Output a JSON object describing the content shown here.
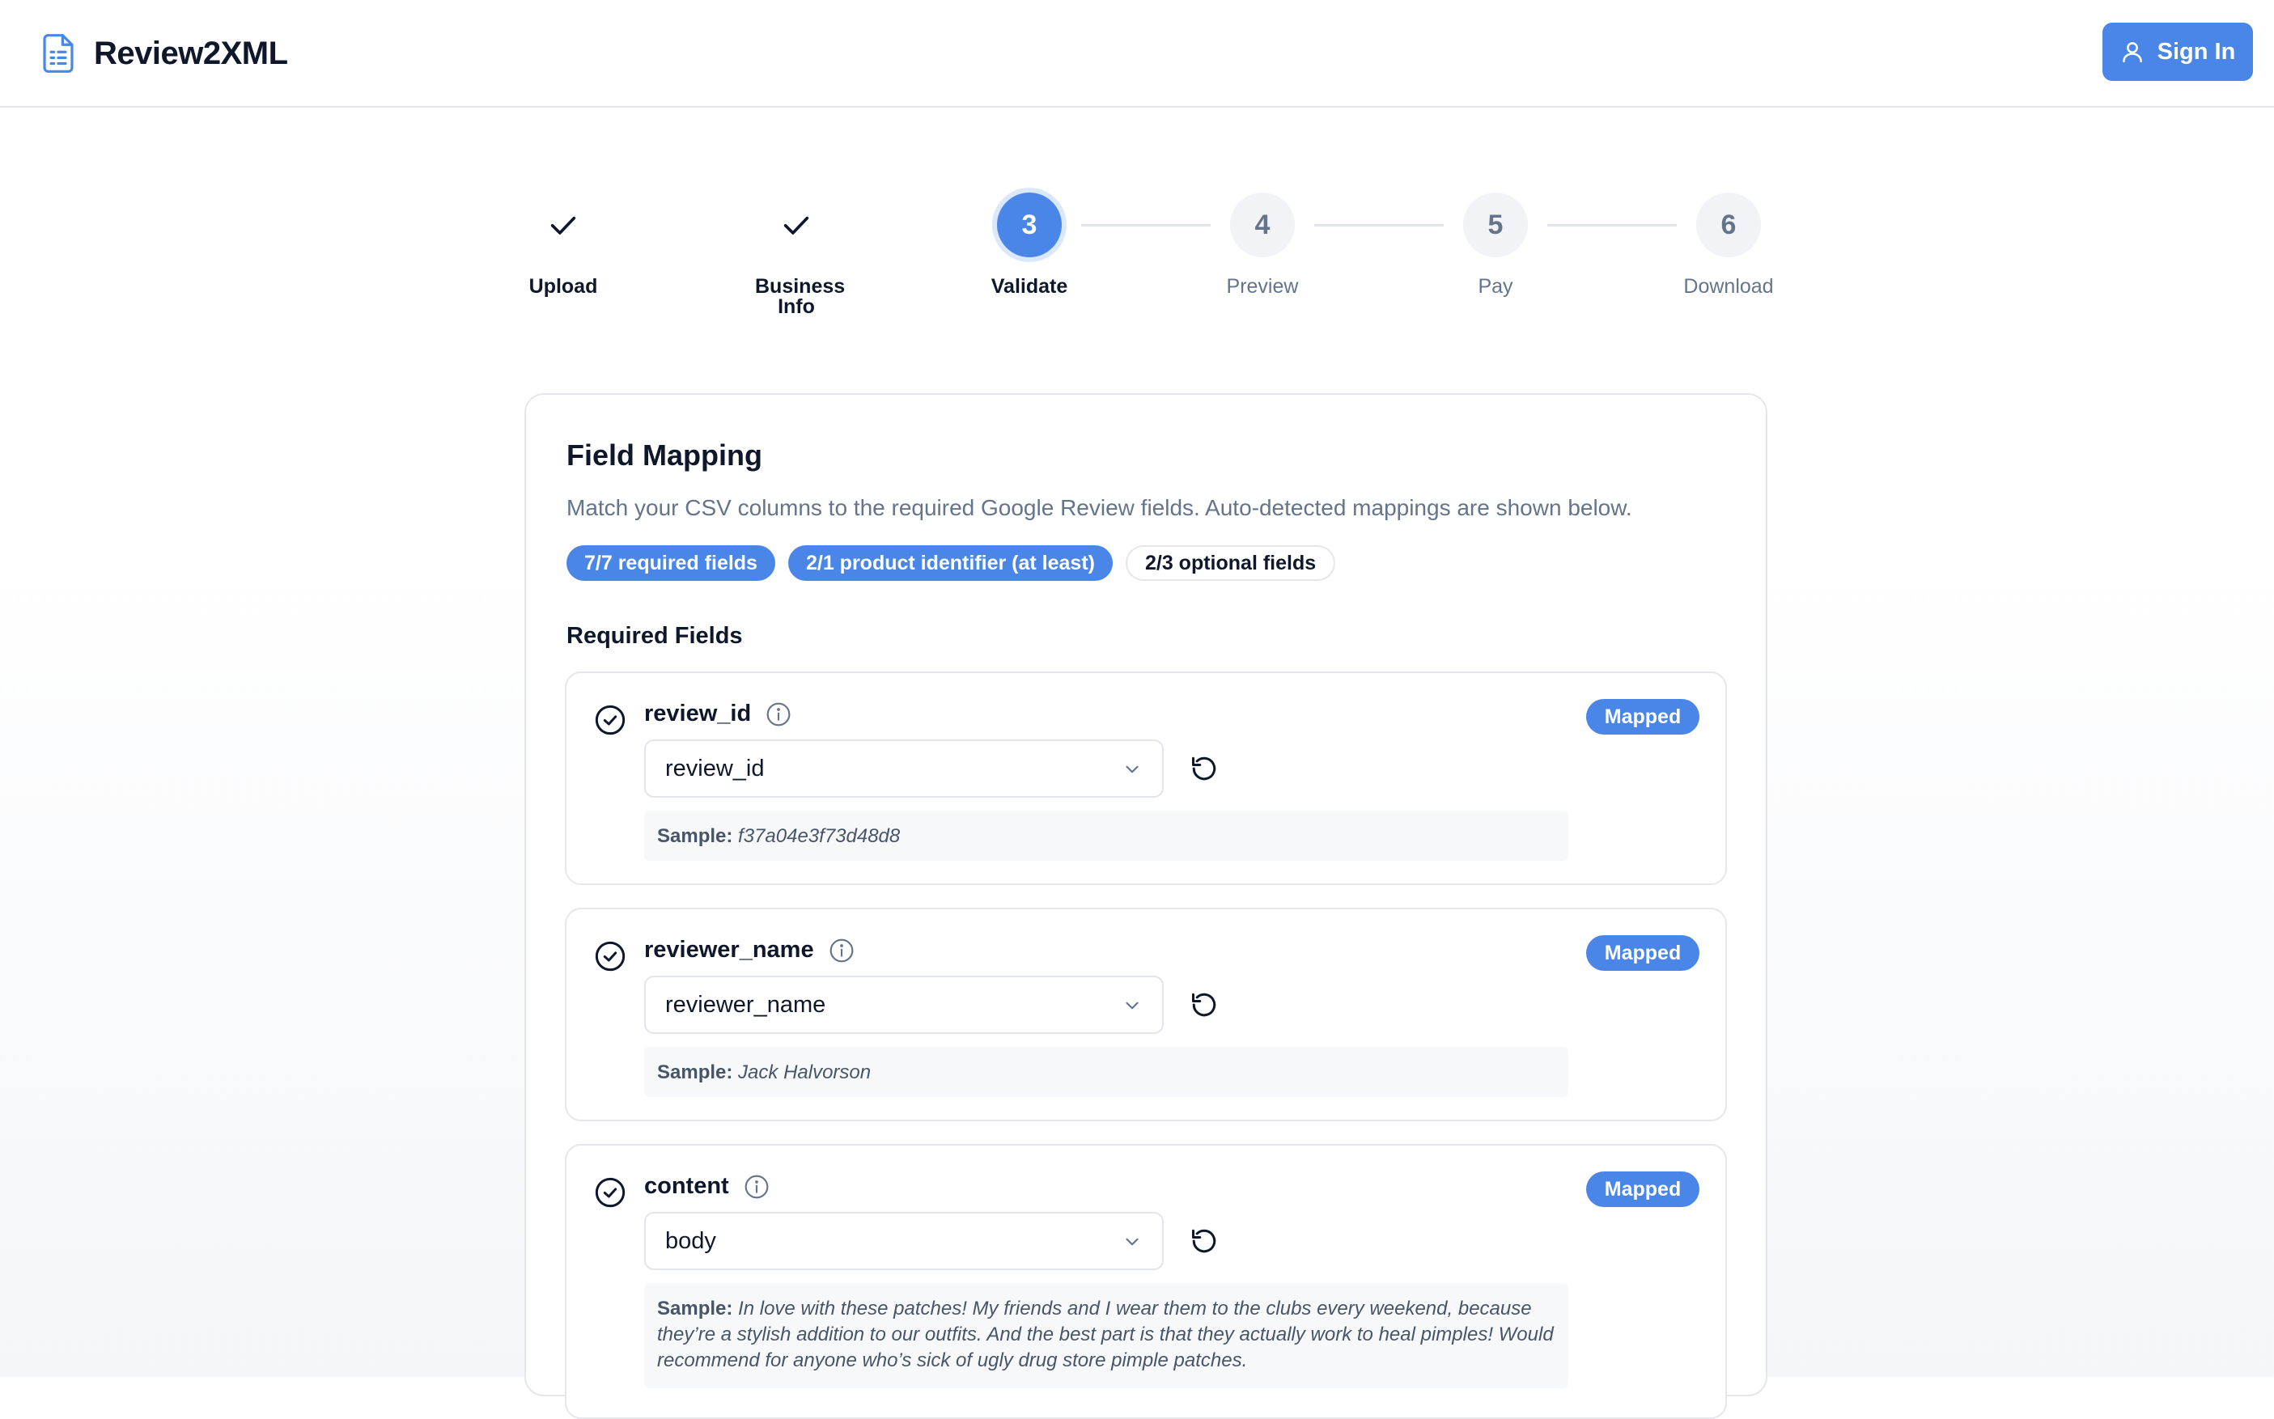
{
  "app": {
    "name": "Review2XML"
  },
  "header": {
    "signin_label": "Sign In"
  },
  "steps": [
    {
      "label": "Upload",
      "state": "done"
    },
    {
      "label": "Business Info",
      "state": "done"
    },
    {
      "label": "Validate",
      "number": "3",
      "state": "active"
    },
    {
      "label": "Preview",
      "number": "4",
      "state": "todo"
    },
    {
      "label": "Pay",
      "number": "5",
      "state": "todo"
    },
    {
      "label": "Download",
      "number": "6",
      "state": "todo"
    }
  ],
  "card": {
    "title": "Field Mapping",
    "description": "Match your CSV columns to the required Google Review fields. Auto-detected mappings are shown below.",
    "badges": [
      {
        "text": "7/7 required fields",
        "style": "filled"
      },
      {
        "text": "2/1 product identifier (at least)",
        "style": "filled"
      },
      {
        "text": "2/3 optional fields",
        "style": "outline"
      }
    ],
    "section_title": "Required Fields",
    "sample_label": "Sample:",
    "fields": [
      {
        "name": "review_id",
        "status": "Mapped",
        "selected": "review_id",
        "sample": "f37a04e3f73d48d8"
      },
      {
        "name": "reviewer_name",
        "status": "Mapped",
        "selected": "reviewer_name",
        "sample": "Jack Halvorson"
      },
      {
        "name": "content",
        "status": "Mapped",
        "selected": "body",
        "sample": "In love with these patches! My friends and I wear them to the clubs every weekend, because they’re a stylish addition to our outfits. And the best part is that they actually work to heal pimples! Would recommend for anyone who’s sick of ugly drug store pimple patches."
      }
    ]
  },
  "colors": {
    "accent": "#4a86e8",
    "muted": "#64748b",
    "border": "#e5e7eb"
  },
  "icons": [
    "document-icon",
    "user-icon",
    "check-icon",
    "check-circle-icon",
    "info-icon",
    "chevron-down-icon",
    "reset-icon"
  ]
}
